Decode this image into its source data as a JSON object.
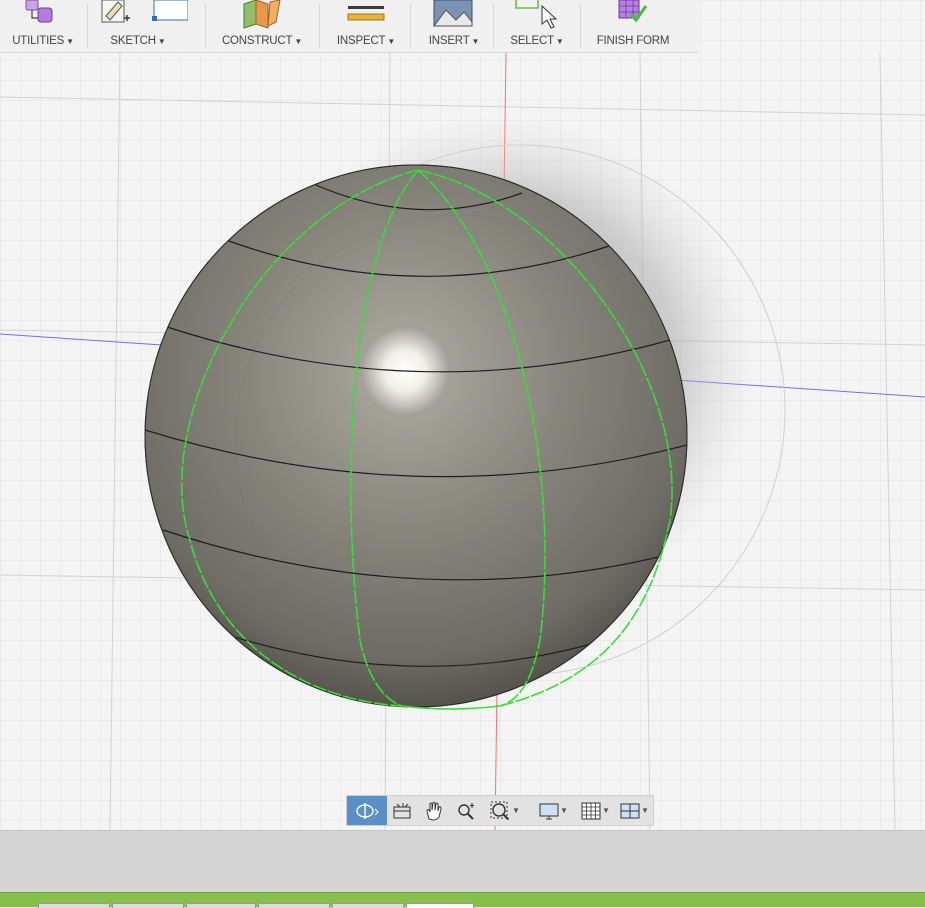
{
  "toolbar": {
    "groups": [
      {
        "label": "UTILITIES",
        "icon": "utilities-icon"
      },
      {
        "label": "SKETCH",
        "icon": "sketch-icon"
      },
      {
        "label": "CONSTRUCT",
        "icon": "construct-icon"
      },
      {
        "label": "INSPECT",
        "icon": "inspect-icon"
      },
      {
        "label": "INSERT",
        "icon": "insert-icon"
      },
      {
        "label": "SELECT",
        "icon": "select-icon"
      },
      {
        "label": "FINISH FORM",
        "icon": "finish-form-icon"
      }
    ],
    "caret": "▼"
  },
  "navbar": {
    "buttons": [
      "orbit-icon",
      "look-at-icon",
      "pan-icon",
      "zoom-icon",
      "fit-zoom-icon",
      "display-settings-icon",
      "grid-settings-icon",
      "viewports-icon"
    ],
    "active": "orbit-icon"
  },
  "colors": {
    "accent": "#5b8fc8",
    "selection_edges": "#33e033",
    "body": "#8a8880",
    "timeline": "#86bf4a"
  }
}
